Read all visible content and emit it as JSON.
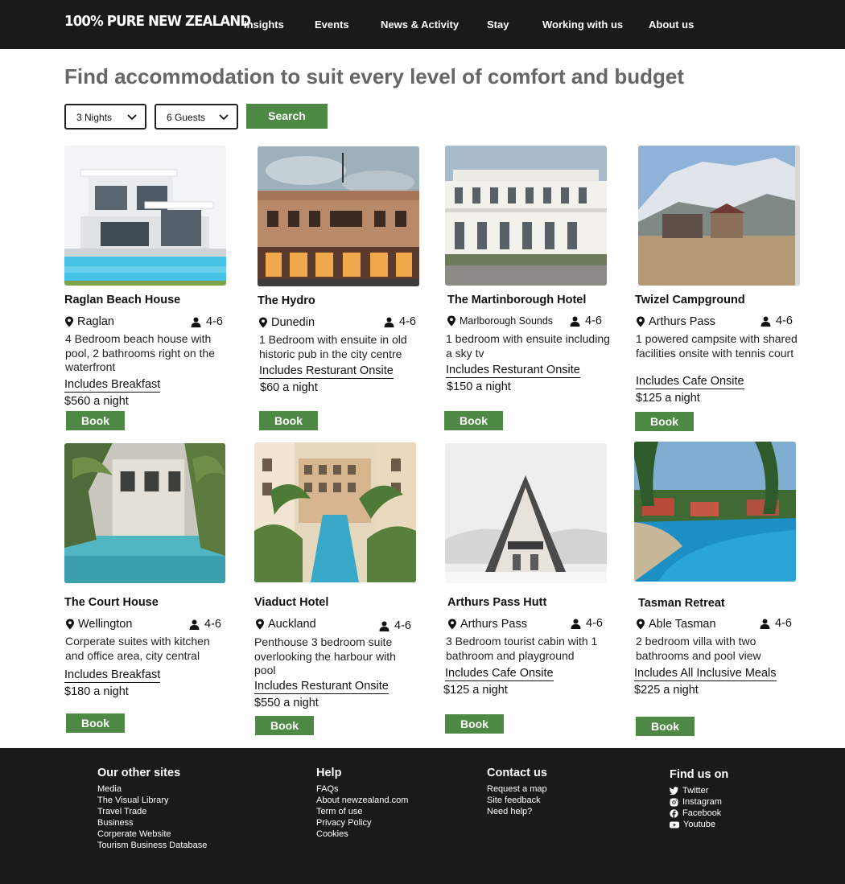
{
  "header": {
    "logo": "100% PURE NEW ZEALAND",
    "nav": [
      "Insights",
      "Events",
      "News & Activity",
      "Stay",
      "Working with us",
      "About us"
    ]
  },
  "main": {
    "title": "Find accommodation to suit every level of comfort and budget",
    "nights": "3 Nights",
    "guests": "6 Guests",
    "search_label": "Search"
  },
  "cards": [
    {
      "name": "Raglan Beach House",
      "location": "Raglan",
      "guests": "4-6",
      "description": "4 Bedroom beach house with pool, 2 bathrooms right on the waterfront",
      "includes": "Includes Breakfast",
      "price": "$560 a night",
      "book": "Book"
    },
    {
      "name": "The Hydro",
      "location": "Dunedin",
      "guests": "4-6",
      "description": "1 Bedroom with ensuite in old historic pub in the city centre",
      "includes": "Includes Resturant Onsite",
      "price": "$60 a night",
      "book": "Book"
    },
    {
      "name": "The Martinborough Hotel",
      "location": "Marlborough Sounds",
      "guests": "4-6",
      "description": "1 bedroom with ensuite including a sky tv",
      "includes": "Includes Resturant Onsite",
      "price": "$150 a night",
      "book": "Book"
    },
    {
      "name": "Twizel Campground",
      "location": "Arthurs Pass",
      "guests": "4-6",
      "description": "1 powered campsite with shared facilities onsite with tennis court",
      "includes": "Includes Cafe Onsite",
      "price": "$125 a night",
      "book": "Book"
    },
    {
      "name": "The Court House",
      "location": "Wellington",
      "guests": "4-6",
      "description": "Corperate suites with kitchen and office area, city central",
      "includes": "Includes Breakfast",
      "price": "$180 a night",
      "book": "Book"
    },
    {
      "name": "Viaduct Hotel",
      "location": "Auckland",
      "guests": "4-6",
      "description": "Penthouse 3 bedroom suite overlooking the harbour with pool",
      "includes": "Includes Resturant Onsite",
      "price": "$550 a night",
      "book": "Book"
    },
    {
      "name": "Arthurs Pass Hutt",
      "location": "Arthurs Pass",
      "guests": "4-6",
      "description": "3 Bedroom tourist cabin with 1 bathroom and playground",
      "includes": "Includes Cafe Onsite",
      "price": "$125 a night",
      "book": "Book"
    },
    {
      "name": "Tasman Retreat",
      "location": "Able Tasman",
      "guests": "4-6",
      "description": "2 bedroom villa with two bathrooms and pool view",
      "includes": "Includes All Inclusive Meals",
      "price": "$225 a night",
      "book": "Book"
    }
  ],
  "footer": {
    "other_sites": {
      "heading": "Our other sites",
      "links": [
        "Media",
        "The Visual Library",
        "Travel Trade",
        "Business",
        "Corperate Website",
        "Tourism Business Database"
      ]
    },
    "help": {
      "heading": "Help",
      "links": [
        "FAQs",
        "About newzealand.com",
        "Term of use",
        "Privacy Policy",
        "Cookies"
      ]
    },
    "contact": {
      "heading": "Contact us",
      "links": [
        "Request a map",
        "Site feedback",
        "Need help?"
      ]
    },
    "social": {
      "heading": "Find us on",
      "links": [
        "Twitter",
        "Instagram",
        "Facebook",
        "Youtube"
      ]
    }
  },
  "colors": {
    "accent_green": "#4e8a45",
    "bar_dark": "#1a1a1a",
    "title_grey": "#666666"
  }
}
